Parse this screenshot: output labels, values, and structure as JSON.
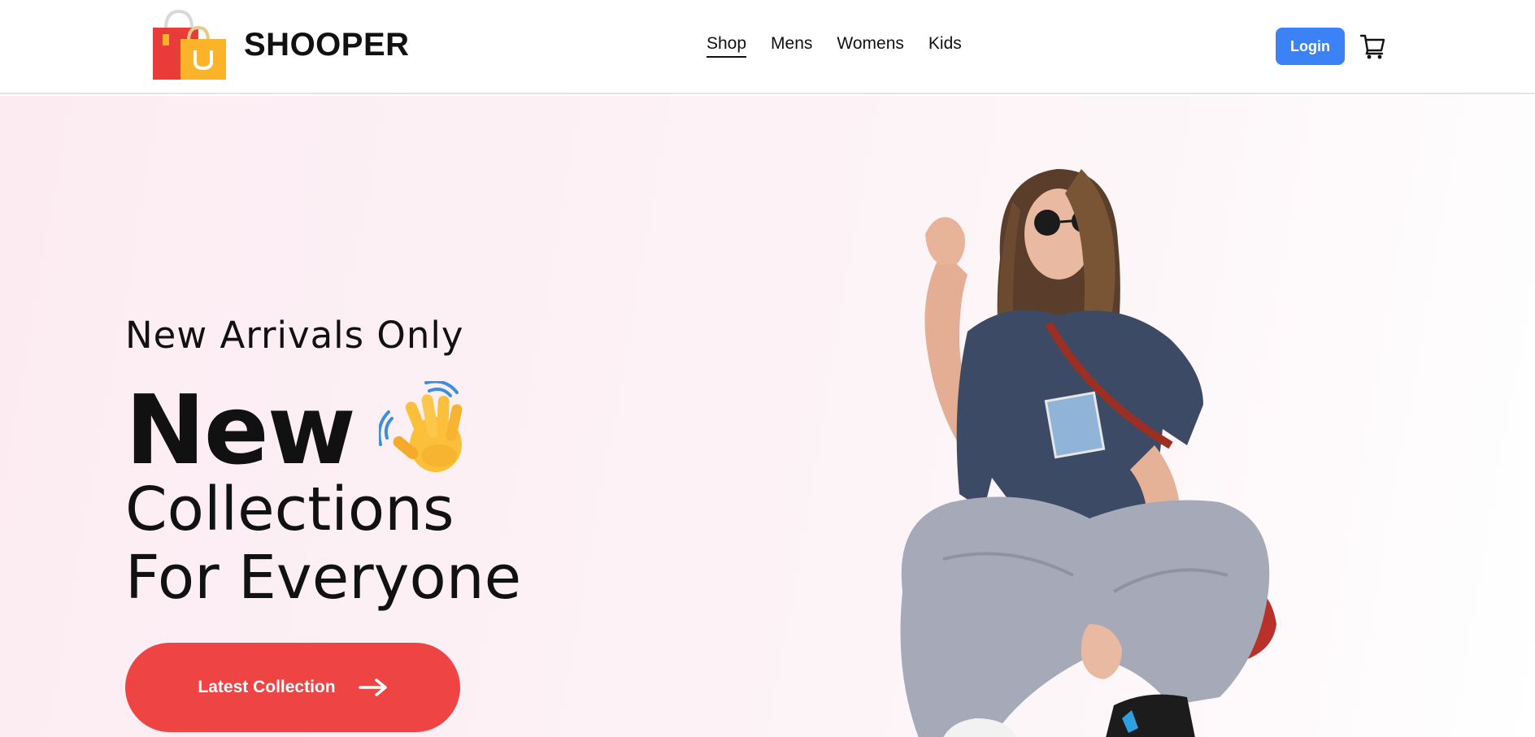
{
  "brand": {
    "name": "SHOOPER",
    "logo_icon": "shopping-bags-icon",
    "logo_letter": "U"
  },
  "nav": {
    "items": [
      {
        "label": "Shop",
        "active": true
      },
      {
        "label": "Mens",
        "active": false
      },
      {
        "label": "Womens",
        "active": false
      },
      {
        "label": "Kids",
        "active": false
      }
    ]
  },
  "header": {
    "login_label": "Login",
    "cart_icon": "shopping-cart-icon"
  },
  "hero": {
    "kicker": "New Arrivals Only",
    "headline_word": "New",
    "headline_emoji": "waving-hand-icon",
    "line2": "Collections",
    "line3": "For Everyone",
    "cta_label": "Latest Collection",
    "cta_icon": "arrow-right-icon",
    "image": "hero-model-image"
  },
  "colors": {
    "accent_blue": "#3b82f6",
    "cta_red": "#ef4444",
    "hero_bg": "#fdf0f5"
  }
}
